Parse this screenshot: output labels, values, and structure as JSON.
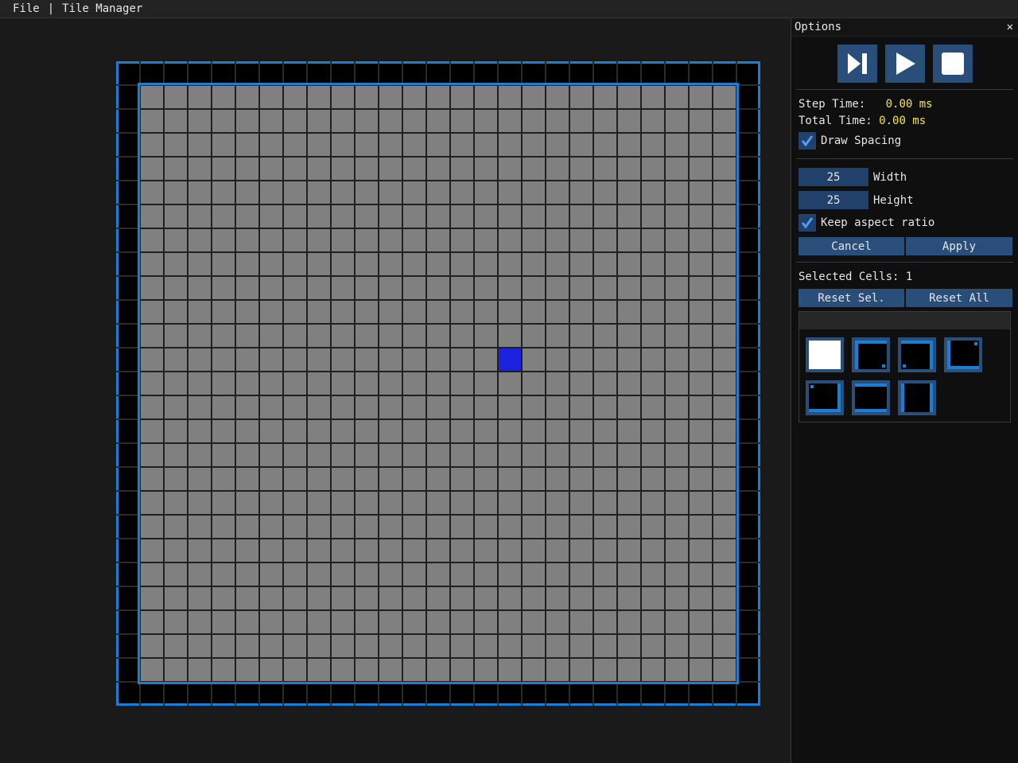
{
  "menu": {
    "file": "File",
    "separator": "|",
    "tile_manager": "Tile Manager"
  },
  "grid": {
    "cols": 25,
    "rows": 25,
    "selected_col": 15,
    "selected_row": 11,
    "colors": {
      "cell": "#808080",
      "line": "#202020",
      "frame": "#1a7fd4",
      "outer": "#000000",
      "selected": "#1c22e0"
    }
  },
  "options": {
    "title": "Options",
    "close_icon": "close-icon",
    "controls": [
      "step-forward-icon",
      "play-icon",
      "stop-icon"
    ],
    "step_time_label": "Step Time:",
    "step_time_value": "0.00 ms",
    "total_time_label": "Total Time:",
    "total_time_value": "0.00 ms",
    "draw_spacing_label": "Draw Spacing",
    "draw_spacing_checked": true,
    "width_value": "25",
    "width_label": "Width",
    "height_value": "25",
    "height_label": "Height",
    "keep_aspect_label": "Keep aspect ratio",
    "keep_aspect_checked": true,
    "cancel_label": "Cancel",
    "apply_label": "Apply",
    "selected_cells_label": "Selected Cells:",
    "selected_cells_value": "1",
    "reset_sel_label": "Reset Sel.",
    "reset_all_label": "Reset All",
    "tiles": [
      "tile-empty",
      "tile-top-left",
      "tile-top-left-corner",
      "tile-bottom-left",
      "tile-top-right",
      "tile-top-bottom",
      "tile-left-right"
    ]
  }
}
